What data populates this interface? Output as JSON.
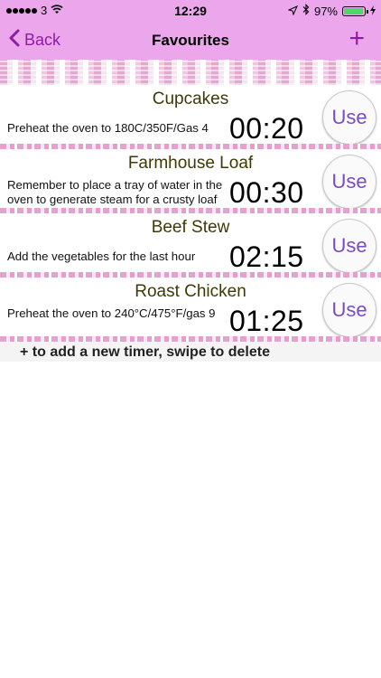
{
  "status": {
    "carrier": "3",
    "time": "12:29",
    "battery": "97%",
    "battery_level": 0.97
  },
  "nav": {
    "back_label": "Back",
    "title": "Favourites",
    "add_label": "+"
  },
  "timers": [
    {
      "name": "Cupcakes",
      "note": "Preheat the oven to 180C/350F/Gas 4",
      "time": "00:20",
      "button": "Use"
    },
    {
      "name": "Farmhouse Loaf",
      "note": "Remember to place a tray of water in the oven to generate steam for a crusty loaf",
      "time": "00:30",
      "button": "Use"
    },
    {
      "name": "Beef Stew",
      "note": "Add the vegetables for the last hour",
      "time": "02:15",
      "button": "Use"
    },
    {
      "name": "Roast Chicken",
      "note": "Preheat the oven to 240°C/475°F/gas 9",
      "time": "01:25",
      "button": "Use"
    }
  ],
  "hint": "+ to add a new timer, swipe to delete",
  "colors": {
    "header_bg": "#eba6ec",
    "accent": "#8e1ca4",
    "title_text": "#3c3a05",
    "use_text": "#7a4bc2"
  }
}
